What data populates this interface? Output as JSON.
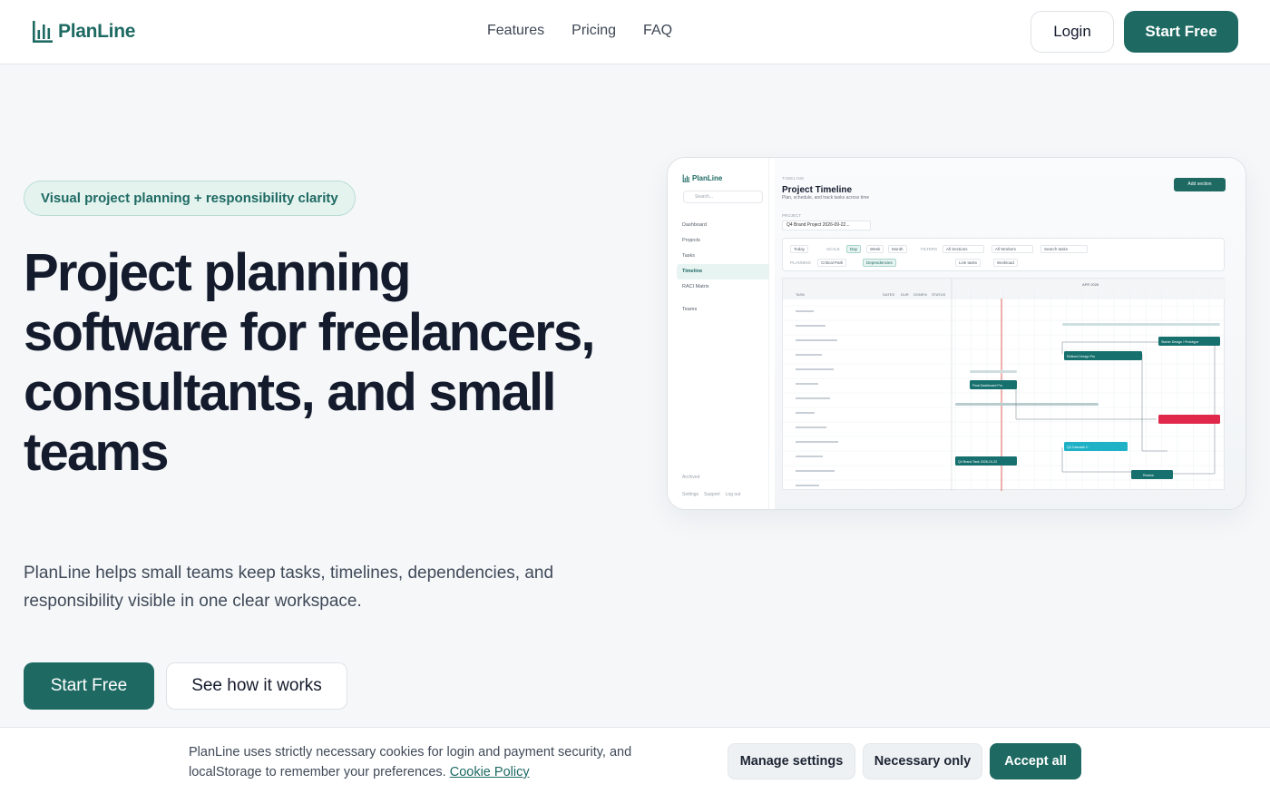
{
  "brand": {
    "name": "PlanLine",
    "color": "#1e6a63",
    "icon": "bar-chart-icon"
  },
  "nav": {
    "items": [
      "Features",
      "Pricing",
      "FAQ"
    ]
  },
  "header": {
    "login_label": "Login",
    "start_label": "Start Free"
  },
  "hero": {
    "badge": "Visual project planning + responsibility clarity",
    "title": "Project planning software for freelancers, consultants, and small teams",
    "subtitle": "PlanLine helps small teams keep tasks, timelines, dependencies, and responsibility visible in one clear workspace.",
    "primary_cta": "Start Free",
    "secondary_cta": "See how it works"
  },
  "preview": {
    "logo": "PlanLine",
    "search_placeholder": "Search...",
    "nav": [
      "Dashboard",
      "Projects",
      "Tasks",
      "Timeline",
      "RACI Matrix",
      "Teams"
    ],
    "active_nav": "Timeline",
    "archived": "Archived",
    "footer": [
      "Settings",
      "Support",
      "Log out"
    ],
    "eyebrow": "TIMELINE",
    "title": "Project Timeline",
    "description": "Plan, schedule, and track tasks across time",
    "add_button": "Add section",
    "project_label": "PROJECT",
    "project_value": "Q4 Brand Project 2026-09-22...",
    "toolbar": {
      "today": "Today",
      "scale_label": "SCALE",
      "scales": [
        "Day",
        "Week",
        "Month"
      ],
      "filters_label": "FILTERS",
      "filters": [
        "All Sections",
        "All Workers",
        "Search tasks"
      ],
      "planning_label": "PLANNING",
      "planning": [
        "Critical Path",
        "Dependencies",
        "Link tasks",
        "Workload"
      ]
    },
    "month_label": "APR 2026",
    "columns": [
      "TASK",
      "DATES",
      "DUR",
      "DONE%",
      "STATUS"
    ],
    "bars": [
      "Starter Design / Prototype",
      "Refined Design Pro",
      "Final Dashboard Pro",
      "Q4 Cascade C",
      "Q4 Brand Task 2026-10-22",
      "Review"
    ]
  },
  "cookie": {
    "text": "PlanLine uses strictly necessary cookies for login and payment security, and localStorage to remember your preferences.",
    "link": "Cookie Policy",
    "manage": "Manage settings",
    "necessary": "Necessary only",
    "accept": "Accept all"
  }
}
